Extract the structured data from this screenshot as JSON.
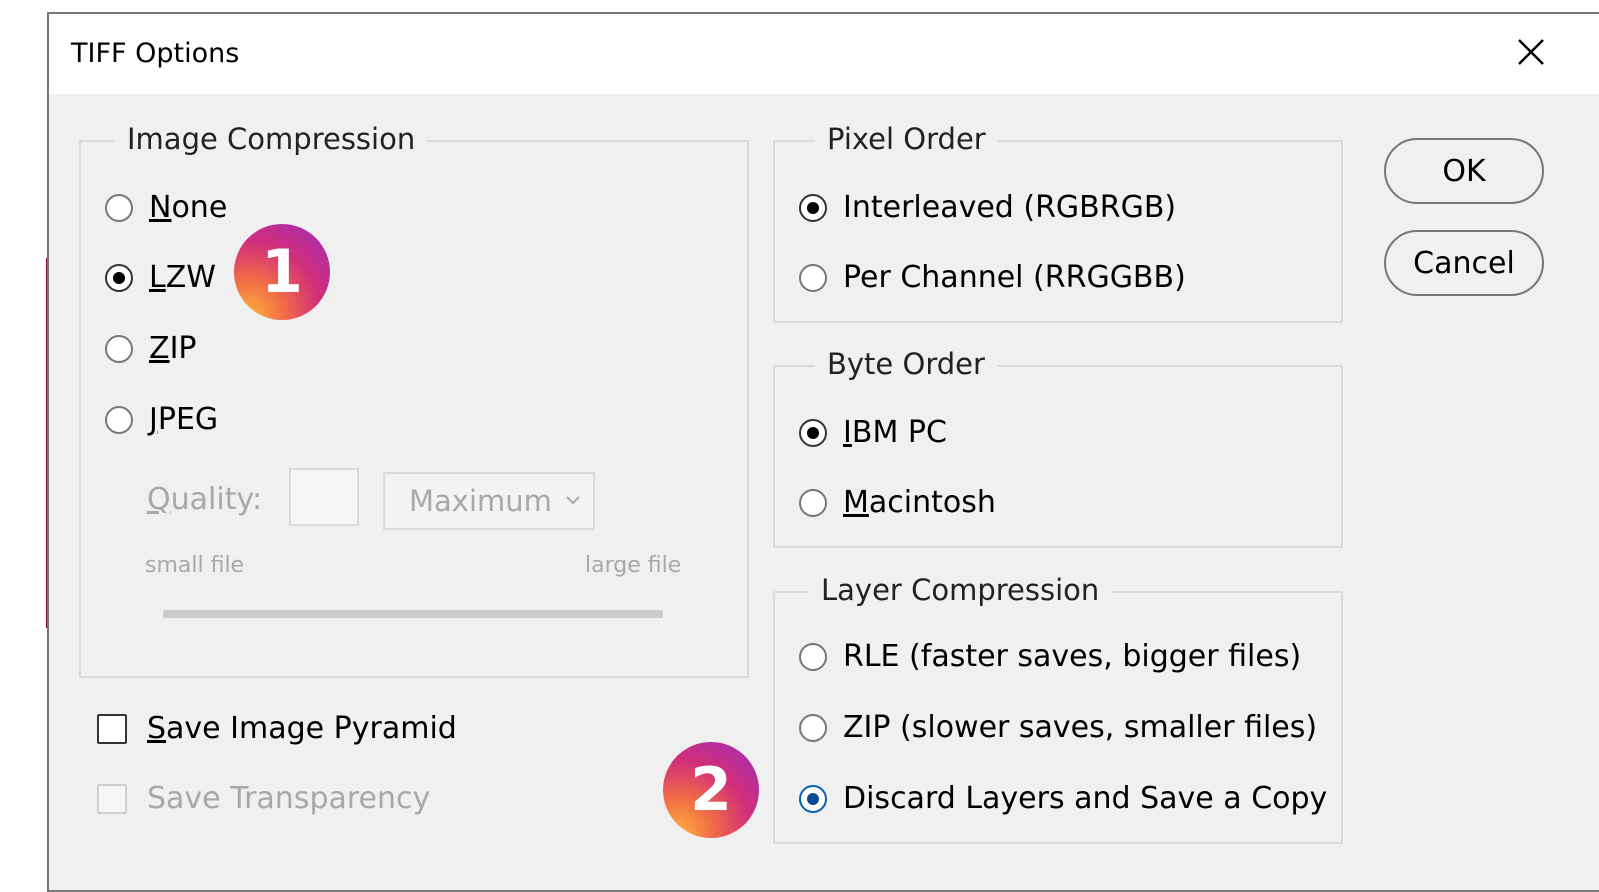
{
  "dialog": {
    "title": "TIFF Options"
  },
  "image_compression": {
    "legend": "Image Compression",
    "options": [
      {
        "label": "None",
        "selected": false
      },
      {
        "label": "LZW",
        "selected": true
      },
      {
        "label": "ZIP",
        "selected": false
      },
      {
        "label": "JPEG",
        "selected": false
      }
    ],
    "quality": {
      "label": "Quality:",
      "value": "",
      "preset": "Maximum",
      "min_label": "small file",
      "max_label": "large file"
    }
  },
  "pixel_order": {
    "legend": "Pixel Order",
    "options": [
      {
        "label": "Interleaved (RGBRGB)",
        "selected": true
      },
      {
        "label": "Per Channel (RRGGBB)",
        "selected": false
      }
    ]
  },
  "byte_order": {
    "legend": "Byte Order",
    "options": [
      {
        "label": "IBM PC",
        "selected": true
      },
      {
        "label": "Macintosh",
        "selected": false
      }
    ]
  },
  "layer_compression": {
    "legend": "Layer Compression",
    "options": [
      {
        "label": "RLE (faster saves, bigger files)",
        "selected": false
      },
      {
        "label": "ZIP (slower saves, smaller files)",
        "selected": false
      },
      {
        "label": "Discard Layers and Save a Copy",
        "selected": true
      }
    ]
  },
  "checkboxes": {
    "save_image_pyramid": {
      "label": "Save Image Pyramid",
      "checked": false,
      "enabled": true
    },
    "save_transparency": {
      "label": "Save Transparency",
      "checked": false,
      "enabled": false
    }
  },
  "buttons": {
    "ok": "OK",
    "cancel": "Cancel"
  },
  "badges": {
    "one": "1",
    "two": "2"
  },
  "colors": {
    "badge_gradient_start": "#ffb03a",
    "badge_gradient_end": "#9b2dbf",
    "accent_strip": "#8a1538"
  }
}
